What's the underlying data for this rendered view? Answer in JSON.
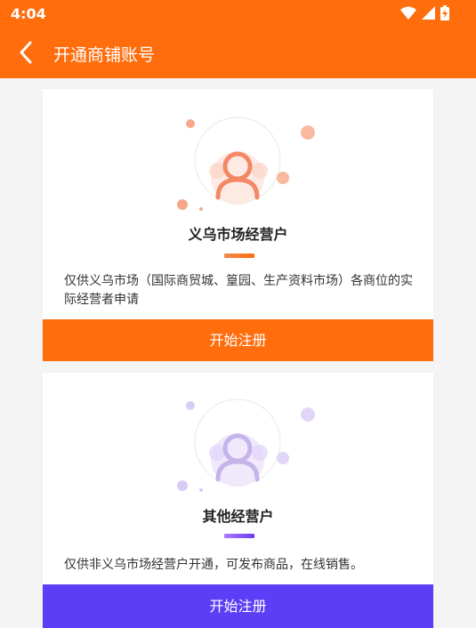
{
  "status_bar": {
    "time": "4:04"
  },
  "header": {
    "title": "开通商铺账号"
  },
  "cards": [
    {
      "title": "义乌市场经营户",
      "description": "仅供义乌市场（国际商贸城、篁园、生产资料市场）各商位的实际经营者申请",
      "button_label": "开始注册",
      "accent_color": "#ff6d0d"
    },
    {
      "title": "其他经营户",
      "description": "仅供非义乌市场经营户开通，可发布商品，在线销售。",
      "button_label": "开始注册",
      "accent_color": "#5b3ef5"
    }
  ],
  "colors": {
    "brand": "#ff6d0d",
    "secondary": "#5b3ef5"
  },
  "icons": [
    "back-arrow-icon",
    "wifi-icon",
    "signal-icon",
    "battery-charging-icon",
    "user-avatar-icon"
  ]
}
